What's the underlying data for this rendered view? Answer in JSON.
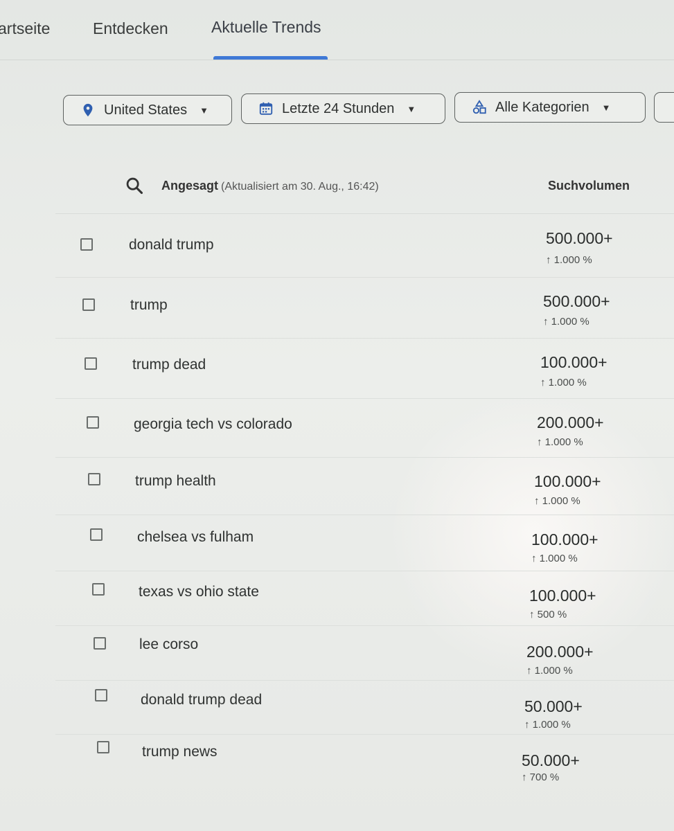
{
  "tabs": [
    {
      "label": "artseite"
    },
    {
      "label": "Entdecken"
    },
    {
      "label": "Aktuelle Trends",
      "active": true
    }
  ],
  "filters": {
    "location": {
      "value": "United States",
      "icon": "location-pin-icon"
    },
    "time": {
      "value": "Letzte 24 Stunden",
      "icon": "calendar-icon"
    },
    "category": {
      "value": "Alle Kategorien",
      "icon": "category-shapes-icon"
    }
  },
  "table": {
    "title": "Angesagt",
    "updated": "(Aktualisiert am 30. Aug., 16:42)",
    "volume_header": "Suchvolumen",
    "arrow": "↑",
    "rows": [
      {
        "term": "donald trump",
        "volume": "500.000+",
        "change": "1.000 %"
      },
      {
        "term": "trump",
        "volume": "500.000+",
        "change": "1.000 %"
      },
      {
        "term": "trump dead",
        "volume": "100.000+",
        "change": "1.000 %"
      },
      {
        "term": "georgia tech vs colorado",
        "volume": "200.000+",
        "change": "1.000 %"
      },
      {
        "term": "trump health",
        "volume": "100.000+",
        "change": "1.000 %"
      },
      {
        "term": "chelsea vs fulham",
        "volume": "100.000+",
        "change": "1.000 %"
      },
      {
        "term": "texas vs ohio state",
        "volume": "100.000+",
        "change": "500 %"
      },
      {
        "term": "lee corso",
        "volume": "200.000+",
        "change": "1.000 %"
      },
      {
        "term": "donald trump dead",
        "volume": "50.000+",
        "change": "1.000 %"
      },
      {
        "term": "trump news",
        "volume": "50.000+",
        "change": "700 %"
      }
    ]
  },
  "colors": {
    "accent": "#3f79d6",
    "background": "#e8eae7"
  }
}
